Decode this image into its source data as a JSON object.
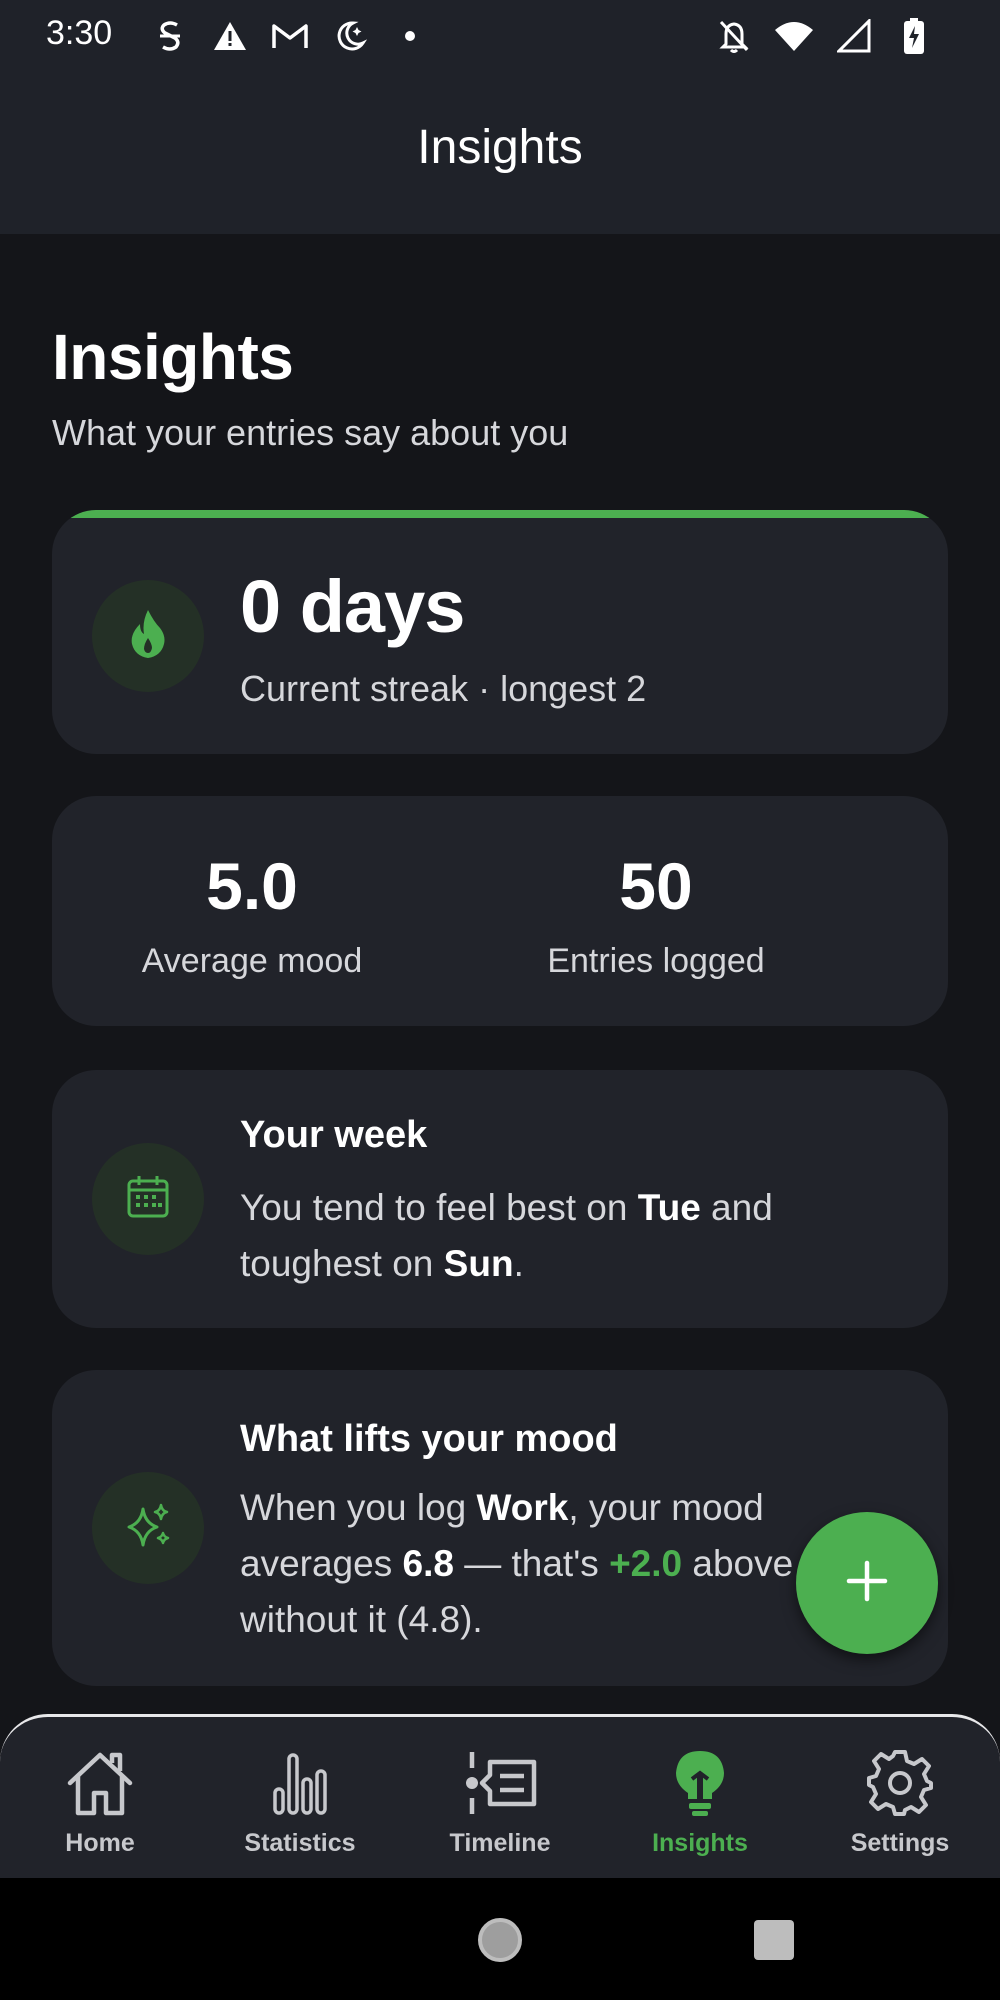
{
  "status_bar": {
    "time": "3:30",
    "left_icons": [
      "s-notification-icon",
      "warning-icon",
      "gmail-icon",
      "do-not-disturb-moon-icon",
      "dot-icon"
    ],
    "right_icons": [
      "bell-off-icon",
      "wifi-icon",
      "signal-icon",
      "battery-charging-icon"
    ]
  },
  "app_bar": {
    "title": "Insights"
  },
  "page": {
    "title": "Insights",
    "subtitle": "What your entries say about you"
  },
  "streak": {
    "icon": "flame-icon",
    "value": "0 days",
    "subtitle": "Current streak · longest 2"
  },
  "stats": {
    "average_mood": {
      "value": "5.0",
      "label": "Average mood"
    },
    "entries": {
      "value": "50",
      "label": "Entries logged"
    }
  },
  "week": {
    "icon": "calendar-icon",
    "title": "Your week",
    "body_pre": "You tend to feel best on ",
    "best_day": "Tue",
    "body_mid": " and toughest on ",
    "worst_day": "Sun",
    "body_end": "."
  },
  "lift": {
    "icon": "sparkles-icon",
    "title": "What lifts your mood",
    "body_pre": "When you log ",
    "activity": "Work",
    "body_mid1": ", your mood averages ",
    "avg_with": "6.8",
    "body_mid2": " — that's ",
    "diff": "+2.0",
    "body_mid3": " above without it (",
    "avg_without": "4.8",
    "body_end": ")."
  },
  "fab": {
    "icon": "plus-icon"
  },
  "bottom_nav": {
    "items": [
      {
        "label": "Home",
        "icon": "home-icon"
      },
      {
        "label": "Statistics",
        "icon": "bar-chart-icon"
      },
      {
        "label": "Timeline",
        "icon": "timeline-icon"
      },
      {
        "label": "Insights",
        "icon": "lightbulb-icon",
        "active": true
      },
      {
        "label": "Settings",
        "icon": "gear-icon"
      }
    ]
  },
  "colors": {
    "accent": "#4caf50",
    "background": "#141519",
    "surface": "#21232a",
    "bar": "#1f2229"
  }
}
